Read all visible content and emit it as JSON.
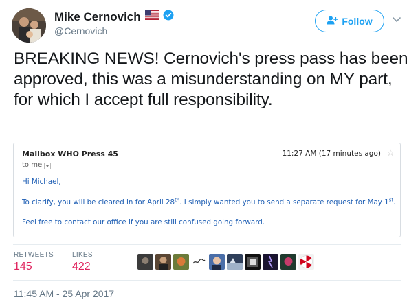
{
  "header": {
    "display_name": "Mike Cernovich",
    "handle": "@Cernovich",
    "follow_label": "Follow"
  },
  "tweet": {
    "text": "BREAKING NEWS! Cernovich's press pass has been approved, this was a misunderstanding on MY part, for which I accept full responsibility.",
    "timestamp": "11:45 AM - 25 Apr 2017"
  },
  "email": {
    "from": "Mailbox WHO Press 45",
    "time": "11:27 AM (17 minutes ago)",
    "to": "to me",
    "greeting": "Hi Michael,",
    "line1_a": "To clarify, you will be cleared in for April 28",
    "line1_sup1": "th",
    "line1_b": ". I simply wanted you to send a separate request for May 1",
    "line1_sup2": "st",
    "line1_c": ".",
    "line2": "Feel free to contact our office if you are still confused going forward."
  },
  "stats": {
    "retweets_label": "RETWEETS",
    "retweets_count": "145",
    "likes_label": "LIKES",
    "likes_count": "422"
  },
  "likers": [
    {
      "name": "liker-1-avatar",
      "color": "#3b3b3b"
    },
    {
      "name": "liker-2-avatar",
      "color": "#5a4634"
    },
    {
      "name": "liker-3-avatar",
      "color": "#6b7b3a"
    },
    {
      "name": "liker-4-avatar",
      "color": "#ffffff"
    },
    {
      "name": "liker-5-avatar",
      "color": "#4a6ea8"
    },
    {
      "name": "liker-6-avatar",
      "color": "#2f3f5a"
    },
    {
      "name": "liker-7-avatar",
      "color": "#111111"
    },
    {
      "name": "liker-8-avatar",
      "color": "#1a1430"
    },
    {
      "name": "liker-9-avatar",
      "color": "#1f3a2e"
    },
    {
      "name": "liker-10-avatar",
      "color": "#f2f2f2"
    }
  ],
  "colors": {
    "accent": "#1da1f2",
    "like": "#e0245e",
    "muted": "#657786",
    "email_link": "#1f5fb4"
  }
}
